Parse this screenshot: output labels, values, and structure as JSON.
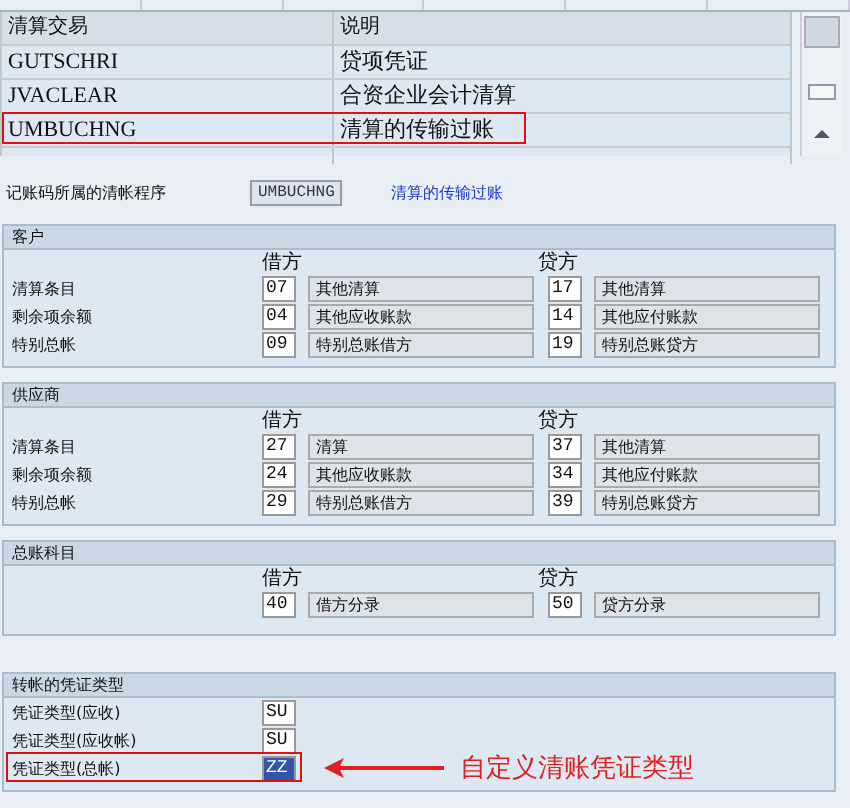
{
  "table": {
    "columns": [
      "清算交易",
      "说明"
    ],
    "rows": [
      {
        "cells": [
          "GUTSCHRI",
          "贷项凭证"
        ],
        "highlighted": false
      },
      {
        "cells": [
          "JVACLEAR",
          "合资企业会计清算"
        ],
        "highlighted": false
      },
      {
        "cells": [
          "UMBUCHNG",
          "清算的传输过账"
        ],
        "highlighted": true
      }
    ]
  },
  "program": {
    "label": "记账码所属的清帐程序",
    "value": "UMBUCHNG",
    "description": "清算的传输过账"
  },
  "sections": [
    {
      "title": "客户",
      "kind": "postings",
      "debit_heading": "借方",
      "credit_heading": "贷方",
      "rows": [
        {
          "label": "清算条目",
          "debit_code": "07",
          "debit_text": "其他清算",
          "credit_code": "17",
          "credit_text": "其他清算"
        },
        {
          "label": "剩余项余额",
          "debit_code": "04",
          "debit_text": "其他应收账款",
          "credit_code": "14",
          "credit_text": "其他应付账款"
        },
        {
          "label": "特别总帐",
          "debit_code": "09",
          "debit_text": "特别总账借方",
          "credit_code": "19",
          "credit_text": "特别总账贷方"
        }
      ]
    },
    {
      "title": "供应商",
      "kind": "postings",
      "debit_heading": "借方",
      "credit_heading": "贷方",
      "rows": [
        {
          "label": "清算条目",
          "debit_code": "27",
          "debit_text": "清算",
          "credit_code": "37",
          "credit_text": "其他清算"
        },
        {
          "label": "剩余项余额",
          "debit_code": "24",
          "debit_text": "其他应收账款",
          "credit_code": "34",
          "credit_text": "其他应付账款"
        },
        {
          "label": "特别总帐",
          "debit_code": "29",
          "debit_text": "特别总账借方",
          "credit_code": "39",
          "credit_text": "特别总账贷方"
        }
      ]
    },
    {
      "title": "总账科目",
      "kind": "postings",
      "debit_heading": "借方",
      "credit_heading": "贷方",
      "rows": [
        {
          "debit_code": "40",
          "debit_text": "借方分录",
          "credit_code": "50",
          "credit_text": "贷方分录"
        }
      ]
    },
    {
      "title": "转帐的凭证类型",
      "kind": "doc_types",
      "rows": [
        {
          "label": "凭证类型(应收)",
          "value": "SU",
          "selected": false,
          "highlighted": false
        },
        {
          "label": "凭证类型(应收帐)",
          "value": "SU",
          "selected": false,
          "highlighted": false
        },
        {
          "label": "凭证类型(总帐)",
          "value": "ZZ",
          "selected": true,
          "highlighted": true,
          "callout": "自定义清账凭证类型"
        }
      ]
    }
  ]
}
